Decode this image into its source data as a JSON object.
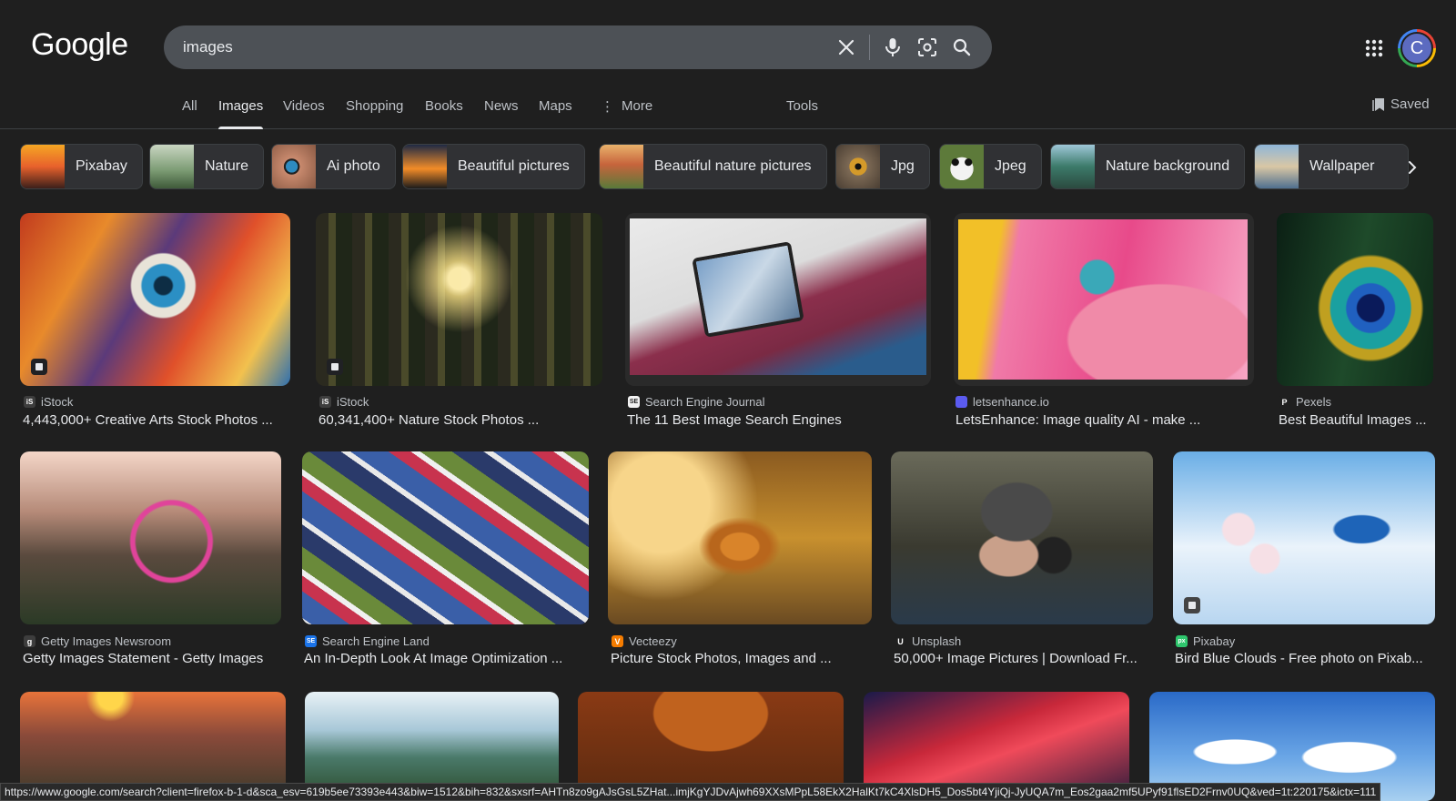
{
  "header": {
    "logo": "Google",
    "search_value": "images",
    "avatar_letter": "C"
  },
  "nav": {
    "tabs": [
      "All",
      "Images",
      "Videos",
      "Shopping",
      "Books",
      "News",
      "Maps",
      "More"
    ],
    "active": "Images",
    "tools": "Tools",
    "saved": "Saved"
  },
  "chips": [
    {
      "label": "Pixabay"
    },
    {
      "label": "Nature"
    },
    {
      "label": "Ai photo"
    },
    {
      "label": "Beautiful pictures"
    },
    {
      "label": "Beautiful nature pictures"
    },
    {
      "label": "Jpg"
    },
    {
      "label": "Jpeg"
    },
    {
      "label": "Nature background"
    },
    {
      "label": "Wallpaper"
    }
  ],
  "results": [
    {
      "source": "iStock",
      "title": "4,443,000+ Creative Arts Stock Photos ...",
      "favicon": "iS",
      "favicon_color": "#3d3d3d"
    },
    {
      "source": "iStock",
      "title": "60,341,400+ Nature Stock Photos ...",
      "favicon": "iS",
      "favicon_color": "#3d3d3d"
    },
    {
      "source": "Search Engine Journal",
      "title": "The 11 Best Image Search Engines",
      "favicon": "SE",
      "favicon_color": "#f2f2f2"
    },
    {
      "source": "letsenhance.io",
      "title": "LetsEnhance: Image quality AI - make ...",
      "favicon": "",
      "favicon_color": "#5b5bf0"
    },
    {
      "source": "Pexels",
      "title": "Best Beautiful Images ...",
      "favicon": "P",
      "favicon_color": "#1f1f1f"
    },
    {
      "source": "Getty Images Newsroom",
      "title": "Getty Images Statement - Getty Images",
      "favicon": "g",
      "favicon_color": "#3d3d3d"
    },
    {
      "source": "Search Engine Land",
      "title": "An In-Depth Look At Image Optimization ...",
      "favicon": "SE",
      "favicon_color": "#1a73e8"
    },
    {
      "source": "Vecteezy",
      "title": "Picture Stock Photos, Images and ...",
      "favicon": "V",
      "favicon_color": "#f57c00"
    },
    {
      "source": "Unsplash",
      "title": "50,000+ Image Pictures | Download Fr...",
      "favicon": "U",
      "favicon_color": "#1f1f1f"
    },
    {
      "source": "Pixabay",
      "title": "Bird Blue Clouds - Free photo on Pixab...",
      "favicon": "px",
      "favicon_color": "#2ec66d"
    }
  ],
  "status_url": "https://www.google.com/search?client=firefox-b-1-d&sca_esv=619b5ee73393e443&biw=1512&bih=832&sxsrf=AHTn8zo9gAJsGsL5ZHat...imjKgYJDvAjwh69XXsMPpL58EkX2HalKt7kC4XlsDH5_Dos5bt4YjiQj-JyUQA7m_Eos2gaa2mf5UPyf91flsED2Frnv0UQ&ved=1t:220175&ictx=111"
}
